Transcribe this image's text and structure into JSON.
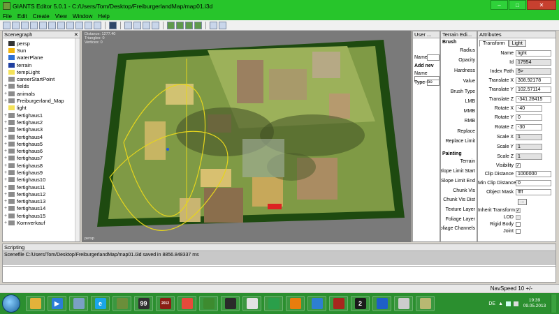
{
  "window": {
    "title": "GIANTS Editor 5.0.1 - C:/Users/Tom/Desktop/FreiburgerlandMap/map01.i3d"
  },
  "menu": [
    "File",
    "Edit",
    "Create",
    "View",
    "Window",
    "Help"
  ],
  "scenegraph": {
    "title": "Scenegraph",
    "close": "✕",
    "items": [
      {
        "label": "persp",
        "icon": "camera-icon",
        "color": "#333333",
        "expand": ""
      },
      {
        "label": "Sun",
        "icon": "sun-icon",
        "color": "#f1b70f",
        "expand": ""
      },
      {
        "label": "waterPlane",
        "icon": "water-plane-icon",
        "color": "#2f6fd4",
        "expand": ""
      },
      {
        "label": "terrain",
        "icon": "terrain-icon",
        "color": "#1f3fa0",
        "expand": ""
      },
      {
        "label": "tempLight",
        "icon": "light-bulb-icon",
        "color": "#f4e25a",
        "expand": ""
      },
      {
        "label": "careerStartPoint",
        "icon": "transform-icon",
        "color": "#8c8c8c",
        "expand": ""
      },
      {
        "label": "fields",
        "icon": "transform-icon",
        "color": "#8c8c8c",
        "expand": "+"
      },
      {
        "label": "animals",
        "icon": "transform-icon",
        "color": "#8c8c8c",
        "expand": "+"
      },
      {
        "label": "Freiburgerland_Map",
        "icon": "transform-icon",
        "color": "#8c8c8c",
        "expand": "+"
      },
      {
        "label": "light",
        "icon": "light-bulb-icon",
        "color": "#f4e25a",
        "expand": ""
      },
      {
        "label": "fertighaus1",
        "icon": "transform-icon",
        "color": "#8c8c8c",
        "expand": "+"
      },
      {
        "label": "fertighaus2",
        "icon": "transform-icon",
        "color": "#8c8c8c",
        "expand": "+"
      },
      {
        "label": "fertighaus3",
        "icon": "transform-icon",
        "color": "#8c8c8c",
        "expand": "+"
      },
      {
        "label": "fertighaus4",
        "icon": "transform-icon",
        "color": "#8c8c8c",
        "expand": "+"
      },
      {
        "label": "fertighaus5",
        "icon": "transform-icon",
        "color": "#8c8c8c",
        "expand": "+"
      },
      {
        "label": "fertighaus6",
        "icon": "transform-icon",
        "color": "#8c8c8c",
        "expand": "+"
      },
      {
        "label": "fertighaus7",
        "icon": "transform-icon",
        "color": "#8c8c8c",
        "expand": "+"
      },
      {
        "label": "fertighaus8",
        "icon": "transform-icon",
        "color": "#8c8c8c",
        "expand": "+"
      },
      {
        "label": "fertighaus9",
        "icon": "transform-icon",
        "color": "#8c8c8c",
        "expand": "+"
      },
      {
        "label": "fertighaus10",
        "icon": "transform-icon",
        "color": "#8c8c8c",
        "expand": "+"
      },
      {
        "label": "fertighaus11",
        "icon": "transform-icon",
        "color": "#8c8c8c",
        "expand": "+"
      },
      {
        "label": "fertighaus12",
        "icon": "transform-icon",
        "color": "#8c8c8c",
        "expand": "+"
      },
      {
        "label": "fertighaus13",
        "icon": "transform-icon",
        "color": "#8c8c8c",
        "expand": "+"
      },
      {
        "label": "fertighaus14",
        "icon": "transform-icon",
        "color": "#8c8c8c",
        "expand": "+"
      },
      {
        "label": "fertighaus15",
        "icon": "transform-icon",
        "color": "#8c8c8c",
        "expand": "+"
      },
      {
        "label": "Kornverkauf",
        "icon": "transform-icon",
        "color": "#8c8c8c",
        "expand": "+"
      }
    ]
  },
  "viewport": {
    "stats": [
      "Distance: 1277.40",
      "Triangles: 0",
      "Vertices: 0"
    ],
    "camera": "persp"
  },
  "user_attrs": {
    "title": "User ...",
    "name_label": "Name",
    "add_label": "Add nev",
    "name2_label": "Name",
    "type_label": "Type",
    "type_value": "bo"
  },
  "terrain": {
    "title": "Terrain Edi...",
    "brush_section": "Brush",
    "brush_rows": [
      "Radius",
      "Opacity",
      "Hardness",
      "Value",
      "Brush Type",
      "LMB",
      "MMB",
      "RMB",
      "Replace",
      "Replace Limit"
    ],
    "painting_section": "Painting",
    "painting_rows": [
      "Terrain",
      "Slope Limit Start",
      "Slope Limit End",
      "Chunk Vis",
      "Chunk Vis Dist",
      "Texture Layer",
      "Foliage Layer",
      "Foliage Channels"
    ]
  },
  "attributes": {
    "title": "Attributes",
    "tabs": [
      "Transform",
      "Light"
    ],
    "rows": [
      {
        "key": "Name",
        "value": "light",
        "ro": false
      },
      {
        "key": "Id",
        "value": "17954",
        "ro": true
      },
      {
        "key": "Index Path",
        "value": "9>",
        "ro": true
      },
      {
        "key": "Translate X",
        "value": "308.92178",
        "ro": false
      },
      {
        "key": "Translate Y",
        "value": "102.57114",
        "ro": false
      },
      {
        "key": "Translate Z",
        "value": "-341.28415",
        "ro": false
      },
      {
        "key": "Rotate X",
        "value": "-40",
        "ro": false
      },
      {
        "key": "Rotate Y",
        "value": "0",
        "ro": false
      },
      {
        "key": "Rotate Z",
        "value": "-30",
        "ro": false
      },
      {
        "key": "Scale X",
        "value": "1",
        "ro": true
      },
      {
        "key": "Scale Y",
        "value": "1",
        "ro": true
      },
      {
        "key": "Scale Z",
        "value": "1",
        "ro": true
      }
    ],
    "visibility_label": "Visibility",
    "clip_label": "Clip Distance",
    "clip_value": "1000000",
    "minclip_label": "Min Clip Distance",
    "minclip_value": "0",
    "mask_label": "Object Mask",
    "mask_value": "ffff",
    "inherit_label": "Inherit Transform",
    "lod_label": "LOD",
    "rigid_label": "Rigid Body",
    "joint_label": "Joint",
    "ellipsis": "..."
  },
  "scripting": {
    "title": "Scripting",
    "output": "Scenefile C:/Users/Tom/Desktop/FreiburgerlandMap/map01.i3d saved in 8856.848337 ms"
  },
  "status": {
    "navspeed": "NavSpeed 10 +/-"
  },
  "taskbar": {
    "lang": "DE",
    "time": "19:39",
    "date": "09.05.2013",
    "apps": [
      {
        "name": "explorer-folder-icon",
        "color": "#e2b23a",
        "glyph": ""
      },
      {
        "name": "media-player-icon",
        "color": "#2b7dd6",
        "glyph": "▶"
      },
      {
        "name": "settings-tool-icon",
        "color": "#7aa0c4",
        "glyph": ""
      },
      {
        "name": "internet-explorer-icon",
        "color": "#1aa6e8",
        "glyph": "e"
      },
      {
        "name": "minecraft-icon",
        "color": "#6b8e3a",
        "glyph": ""
      },
      {
        "name": "game-99-icon",
        "color": "#2f2f2f",
        "glyph": "99"
      },
      {
        "name": "farming-simulator-2012-icon",
        "color": "#8a1f14",
        "glyph": "2012"
      },
      {
        "name": "chrome-icon",
        "color": "#e64a3b",
        "glyph": ""
      },
      {
        "name": "tractor-icon",
        "color": "#3d8b2f",
        "glyph": ""
      },
      {
        "name": "giants-editor-icon",
        "color": "#2a2a2a",
        "glyph": ""
      },
      {
        "name": "fs-logo-icon",
        "color": "#e2e2e2",
        "glyph": ""
      },
      {
        "name": "chat-icon",
        "color": "#2a9f4a",
        "glyph": ""
      },
      {
        "name": "blender-icon",
        "color": "#e87d0d",
        "glyph": ""
      },
      {
        "name": "network-icon",
        "color": "#2d7fd0",
        "glyph": ""
      },
      {
        "name": "vehicle-icon",
        "color": "#a8261e",
        "glyph": ""
      },
      {
        "name": "app-2-icon",
        "color": "#1a1a1a",
        "glyph": "2"
      },
      {
        "name": "messenger-icon",
        "color": "#1e5fc7",
        "glyph": ""
      },
      {
        "name": "notepad-icon",
        "color": "#cccccc",
        "glyph": ""
      },
      {
        "name": "minimized-window-icon",
        "color": "#b8b872",
        "glyph": ""
      }
    ]
  },
  "colors": {
    "title_bg": "#27c52b",
    "taskbar_bg": "#2b8f2f"
  }
}
